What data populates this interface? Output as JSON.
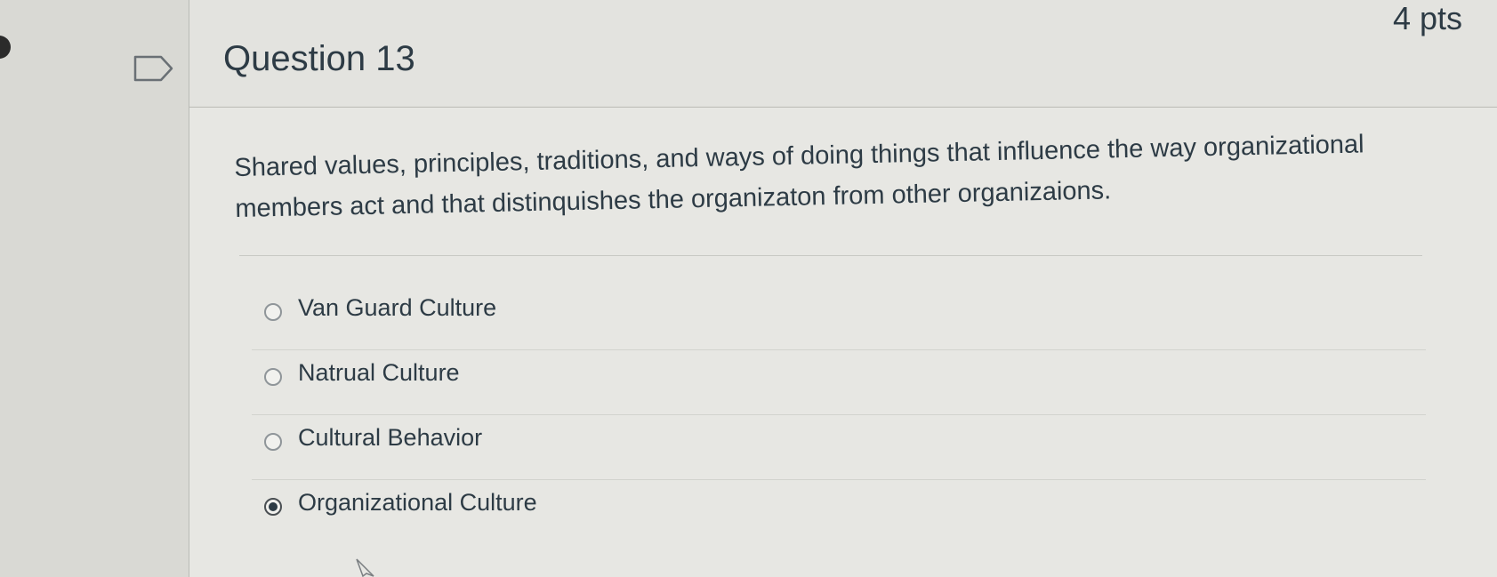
{
  "question": {
    "title": "Question 13",
    "points": "4 pts",
    "prompt": "Shared values, principles, traditions, and ways of doing things that influence the way organizational members act and that distinquishes the organizaton from other organizaions."
  },
  "answers": [
    {
      "label": "Van Guard Culture",
      "selected": false
    },
    {
      "label": "Natrual Culture",
      "selected": false
    },
    {
      "label": "Cultural Behavior",
      "selected": false
    },
    {
      "label": "Organizational Culture",
      "selected": true
    }
  ],
  "colors": {
    "text": "#2d3b45",
    "header_bg": "#e3e3df",
    "body_bg": "#e7e7e3",
    "selected_radio": "#2d3b45"
  },
  "icons": {
    "flag": "flag-outline-icon",
    "cursor": "mouse-pointer-icon"
  }
}
